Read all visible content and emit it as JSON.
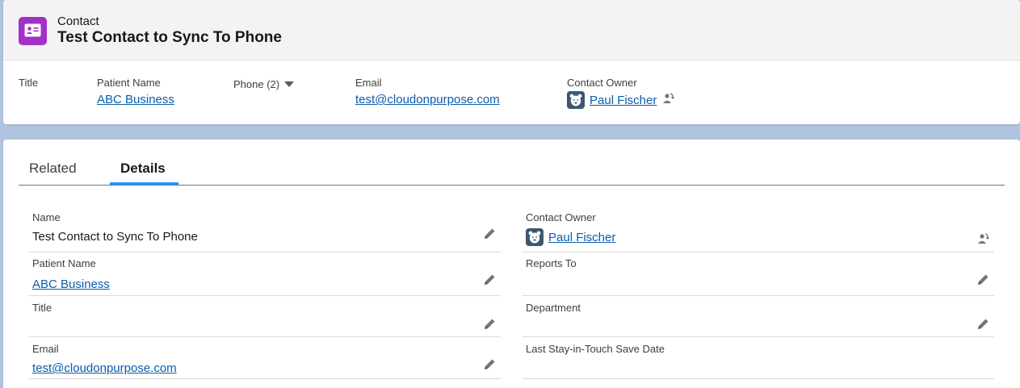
{
  "header": {
    "object_type": "Contact",
    "record_title": "Test Contact to Sync To Phone"
  },
  "highlights": {
    "title_label": "Title",
    "patient_name_label": "Patient Name",
    "patient_name_value": "ABC Business",
    "phone_label": "Phone (2)",
    "email_label": "Email",
    "email_value": "test@cloudonpurpose.com",
    "owner_label": "Contact Owner",
    "owner_value": "Paul Fischer"
  },
  "tabs": {
    "related": "Related",
    "details": "Details"
  },
  "details": {
    "name_label": "Name",
    "name_value": "Test Contact to Sync To Phone",
    "patient_name_label": "Patient Name",
    "patient_name_value": "ABC Business",
    "title_label": "Title",
    "email_label": "Email",
    "email_value": "test@cloudonpurpose.com",
    "owner_label": "Contact Owner",
    "owner_value": "Paul Fischer",
    "reports_to_label": "Reports To",
    "department_label": "Department",
    "last_stay_label": "Last Stay-in-Touch Save Date"
  },
  "colors": {
    "accent": "#1b96ff",
    "link": "#0b5cab",
    "contact_icon": "#a230c7",
    "page_background": "#b0c4df"
  },
  "icons": [
    "contact-card-icon",
    "dropdown-caret-icon",
    "user-avatar-icon",
    "change-owner-icon",
    "pencil-edit-icon"
  ]
}
